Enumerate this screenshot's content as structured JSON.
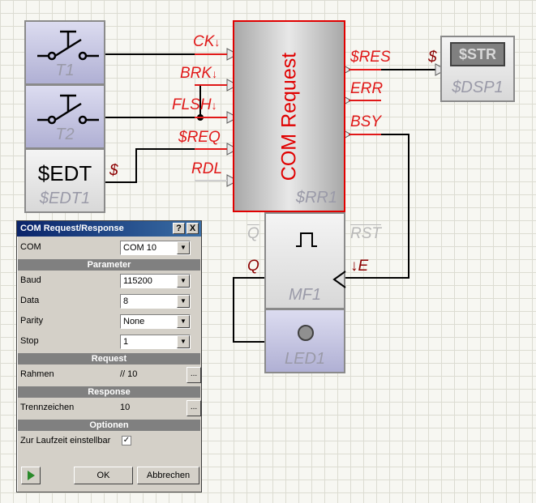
{
  "colors": {
    "red": "#e01818",
    "dark_red": "#8c0000",
    "wire": "#000000"
  },
  "blocks": {
    "t1": {
      "label": "T1",
      "icon": "pushbutton-switch-icon"
    },
    "t2": {
      "label": "T2",
      "icon": "pushbutton-switch-icon"
    },
    "edt1": {
      "text": "$EDT",
      "label": "$EDT1",
      "pin_dollar": "$"
    },
    "com": {
      "title": "COM Request",
      "label": "$RR1",
      "inputs": [
        "CK",
        "BRK",
        "FLSH",
        "$REQ",
        "RDL"
      ],
      "edge_marker": "↓",
      "outputs": [
        "$RES",
        "ERR",
        "BSY"
      ]
    },
    "dsp1": {
      "text": "$STR",
      "label": "$DSP1",
      "pin_dollar": "$"
    },
    "mf1": {
      "label": "MF1",
      "icon": "pulse-icon",
      "q_bar": "Q",
      "rst_bar": "RST",
      "q": "Q",
      "e": "↓E"
    },
    "led1": {
      "label": "LED1",
      "icon": "led-icon"
    }
  },
  "dialog": {
    "title": "COM Request/Response",
    "help_btn": "?",
    "close_btn": "X",
    "com_label": "COM",
    "com_value": "COM 10",
    "section_parameter": "Parameter",
    "baud_label": "Baud",
    "baud_value": "115200",
    "data_label": "Data",
    "data_value": "8",
    "parity_label": "Parity",
    "parity_value": "None",
    "stop_label": "Stop",
    "stop_value": "1",
    "section_request": "Request",
    "rahmen_label": "Rahmen",
    "rahmen_value": "// 10",
    "section_response": "Response",
    "trenn_label": "Trennzeichen",
    "trenn_value": "10",
    "ellipsis": "...",
    "section_optionen": "Optionen",
    "laufzeit_label": "Zur Laufzeit einstellbar",
    "check_mark": "✓",
    "ok_label": "OK",
    "cancel_label": "Abbrechen"
  }
}
